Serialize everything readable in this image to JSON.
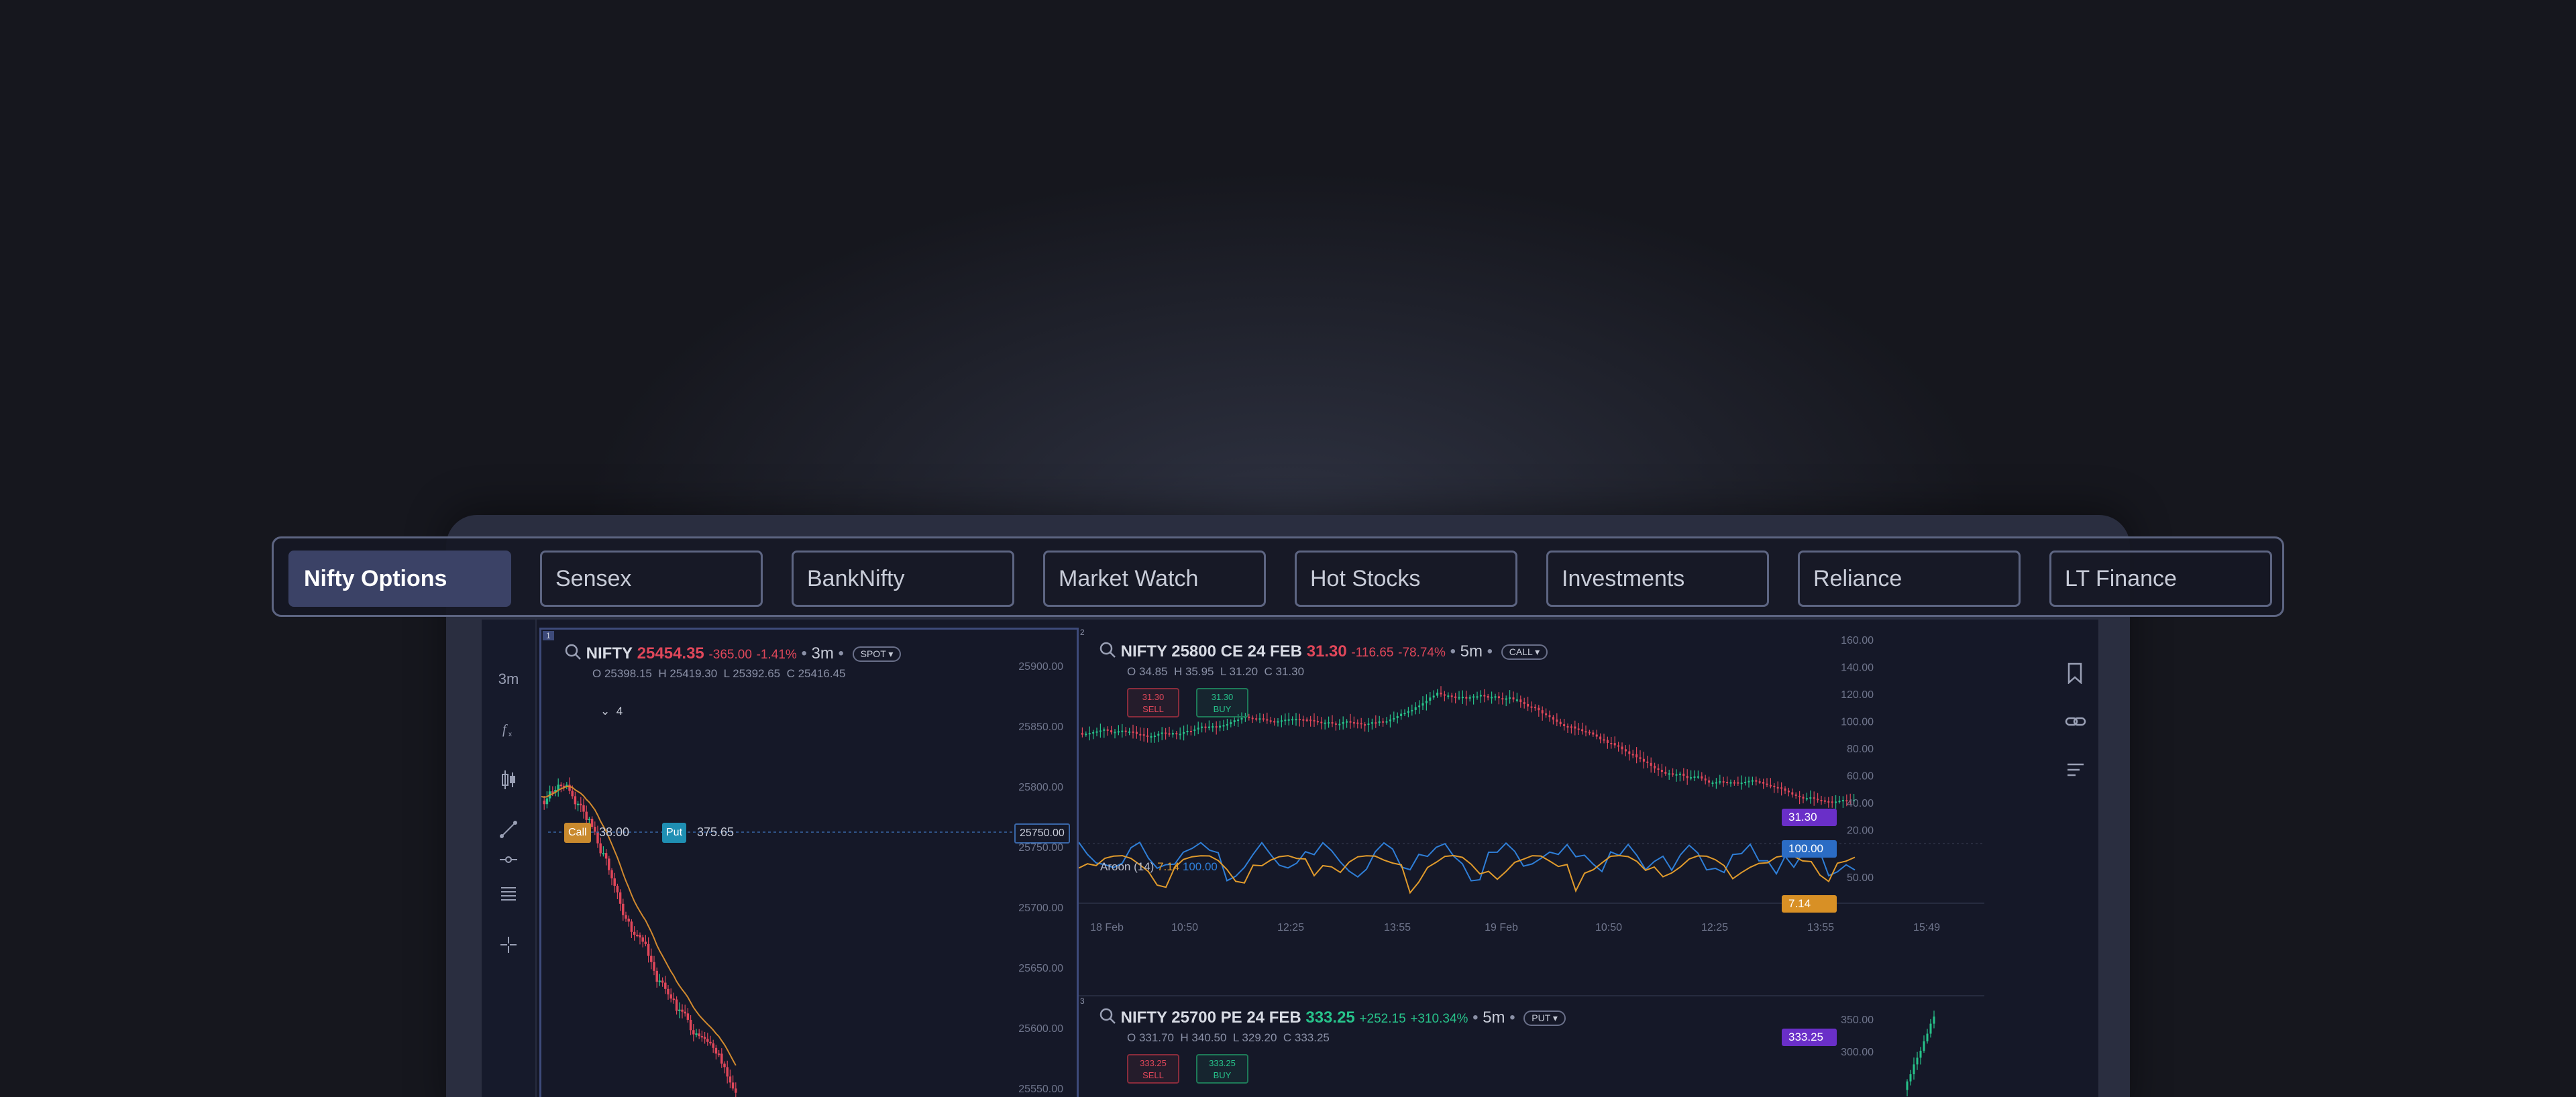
{
  "tabs": [
    {
      "label": "Nifty Options",
      "active": true
    },
    {
      "label": "Sensex",
      "active": false
    },
    {
      "label": "BankNifty",
      "active": false
    },
    {
      "label": "Market Watch",
      "active": false
    },
    {
      "label": "Hot Stocks",
      "active": false
    },
    {
      "label": "Investments",
      "active": false
    },
    {
      "label": "Reliance",
      "active": false
    },
    {
      "label": "LT Finance",
      "active": false
    }
  ],
  "toolbar": {
    "interval": "3m"
  },
  "pane1": {
    "index": "1",
    "symbol": "NIFTY",
    "price": "25454.35",
    "change": "-365.00",
    "change_pct": "-1.41%",
    "interval": "3m",
    "tag": "SPOT",
    "ohlc": {
      "o": "O 25398.15",
      "h": "H 25419.30",
      "l": "L 25392.65",
      "c": "C 25416.45"
    },
    "collapse_count": "4",
    "call_label": "Call",
    "call_value": "38.00",
    "put_label": "Put",
    "put_value": "375.65",
    "strike_badge": "25750.00",
    "y_ticks": [
      "25900.00",
      "25850.00",
      "25800.00",
      "25750.00",
      "25700.00",
      "25650.00",
      "25600.00",
      "25550.00"
    ]
  },
  "pane2": {
    "index": "2",
    "symbol": "NIFTY 25800 CE 24 FEB",
    "price": "31.30",
    "change": "-116.65",
    "change_pct": "-78.74%",
    "interval": "5m",
    "tag": "CALL",
    "ohlc": {
      "o": "O 34.85",
      "h": "H 35.95",
      "l": "L 31.20",
      "c": "C 31.30"
    },
    "sell": {
      "price": "31.30",
      "label": "SELL"
    },
    "buy": {
      "price": "31.30",
      "label": "BUY"
    },
    "y_ticks": [
      "160.00",
      "140.00",
      "120.00",
      "100.00",
      "80.00",
      "60.00",
      "40.00",
      "20.00"
    ],
    "last_price_badge": "31.30",
    "indicator": {
      "name": "Aroon (14)",
      "v1": "7.14",
      "v2": "100.00",
      "y_ticks": [
        "50.00"
      ],
      "badge_up": "100.00",
      "badge_down": "7.14"
    },
    "x_ticks": [
      "18 Feb",
      "10:50",
      "12:25",
      "13:55",
      "19 Feb",
      "10:50",
      "12:25",
      "13:55",
      "15:49"
    ]
  },
  "pane3": {
    "index": "3",
    "symbol": "NIFTY 25700 PE 24 FEB",
    "price": "333.25",
    "change": "+252.15",
    "change_pct": "+310.34%",
    "interval": "5m",
    "tag": "PUT",
    "ohlc": {
      "o": "O 331.70",
      "h": "H 340.50",
      "l": "L 329.20",
      "c": "C 333.25"
    },
    "sell": {
      "price": "333.25",
      "label": "SELL"
    },
    "buy": {
      "price": "333.25",
      "label": "BUY"
    },
    "y_ticks": [
      "350.00",
      "300.00"
    ],
    "last_price_badge": "333.25"
  },
  "colors": {
    "up": "#27c28a",
    "down": "#e0475a",
    "accent": "#3b4266",
    "call_badge": "#c98a2e",
    "put_badge": "#1f8fb3",
    "aroon_up": "#2f7fd8",
    "aroon_down": "#e19b2c",
    "last_price": "#6a2fc8"
  }
}
